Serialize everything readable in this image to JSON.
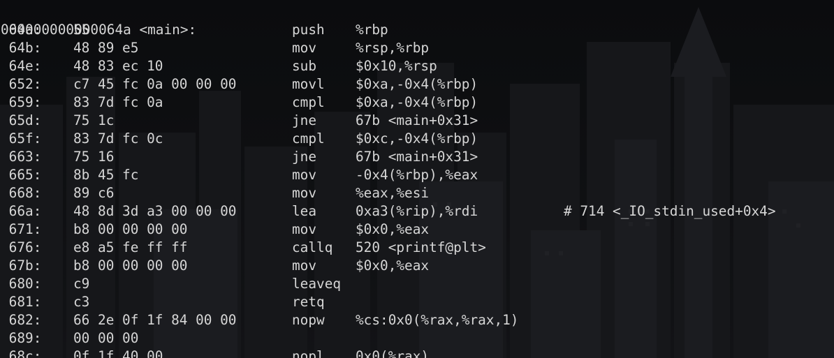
{
  "header": "000000000000064a <main>:",
  "lines": [
    {
      "addr": " 64a:",
      "bytes": "55",
      "mnem": "push",
      "ops": "%rbp",
      "comment": ""
    },
    {
      "addr": " 64b:",
      "bytes": "48 89 e5",
      "mnem": "mov",
      "ops": "%rsp,%rbp",
      "comment": ""
    },
    {
      "addr": " 64e:",
      "bytes": "48 83 ec 10",
      "mnem": "sub",
      "ops": "$0x10,%rsp",
      "comment": ""
    },
    {
      "addr": " 652:",
      "bytes": "c7 45 fc 0a 00 00 00",
      "mnem": "movl",
      "ops": "$0xa,-0x4(%rbp)",
      "comment": ""
    },
    {
      "addr": " 659:",
      "bytes": "83 7d fc 0a",
      "mnem": "cmpl",
      "ops": "$0xa,-0x4(%rbp)",
      "comment": ""
    },
    {
      "addr": " 65d:",
      "bytes": "75 1c",
      "mnem": "jne",
      "ops": "67b <main+0x31>",
      "comment": ""
    },
    {
      "addr": " 65f:",
      "bytes": "83 7d fc 0c",
      "mnem": "cmpl",
      "ops": "$0xc,-0x4(%rbp)",
      "comment": ""
    },
    {
      "addr": " 663:",
      "bytes": "75 16",
      "mnem": "jne",
      "ops": "67b <main+0x31>",
      "comment": ""
    },
    {
      "addr": " 665:",
      "bytes": "8b 45 fc",
      "mnem": "mov",
      "ops": "-0x4(%rbp),%eax",
      "comment": ""
    },
    {
      "addr": " 668:",
      "bytes": "89 c6",
      "mnem": "mov",
      "ops": "%eax,%esi",
      "comment": ""
    },
    {
      "addr": " 66a:",
      "bytes": "48 8d 3d a3 00 00 00",
      "mnem": "lea",
      "ops": "0xa3(%rip),%rdi",
      "comment": "# 714 <_IO_stdin_used+0x4>"
    },
    {
      "addr": " 671:",
      "bytes": "b8 00 00 00 00",
      "mnem": "mov",
      "ops": "$0x0,%eax",
      "comment": ""
    },
    {
      "addr": " 676:",
      "bytes": "e8 a5 fe ff ff",
      "mnem": "callq",
      "ops": "520 <printf@plt>",
      "comment": ""
    },
    {
      "addr": " 67b:",
      "bytes": "b8 00 00 00 00",
      "mnem": "mov",
      "ops": "$0x0,%eax",
      "comment": ""
    },
    {
      "addr": " 680:",
      "bytes": "c9",
      "mnem": "leaveq",
      "ops": "",
      "comment": ""
    },
    {
      "addr": " 681:",
      "bytes": "c3",
      "mnem": "retq",
      "ops": "",
      "comment": ""
    },
    {
      "addr": " 682:",
      "bytes": "66 2e 0f 1f 84 00 00",
      "mnem": "nopw",
      "ops": "%cs:0x0(%rax,%rax,1)",
      "comment": ""
    },
    {
      "addr": " 689:",
      "bytes": "00 00 00",
      "mnem": "",
      "ops": "",
      "comment": ""
    },
    {
      "addr": " 68c:",
      "bytes": "0f 1f 40 00",
      "mnem": "nopl",
      "ops": "0x0(%rax)",
      "comment": ""
    }
  ],
  "colors": {
    "text": "#d6d6d6",
    "background": "#0c0d0f"
  }
}
